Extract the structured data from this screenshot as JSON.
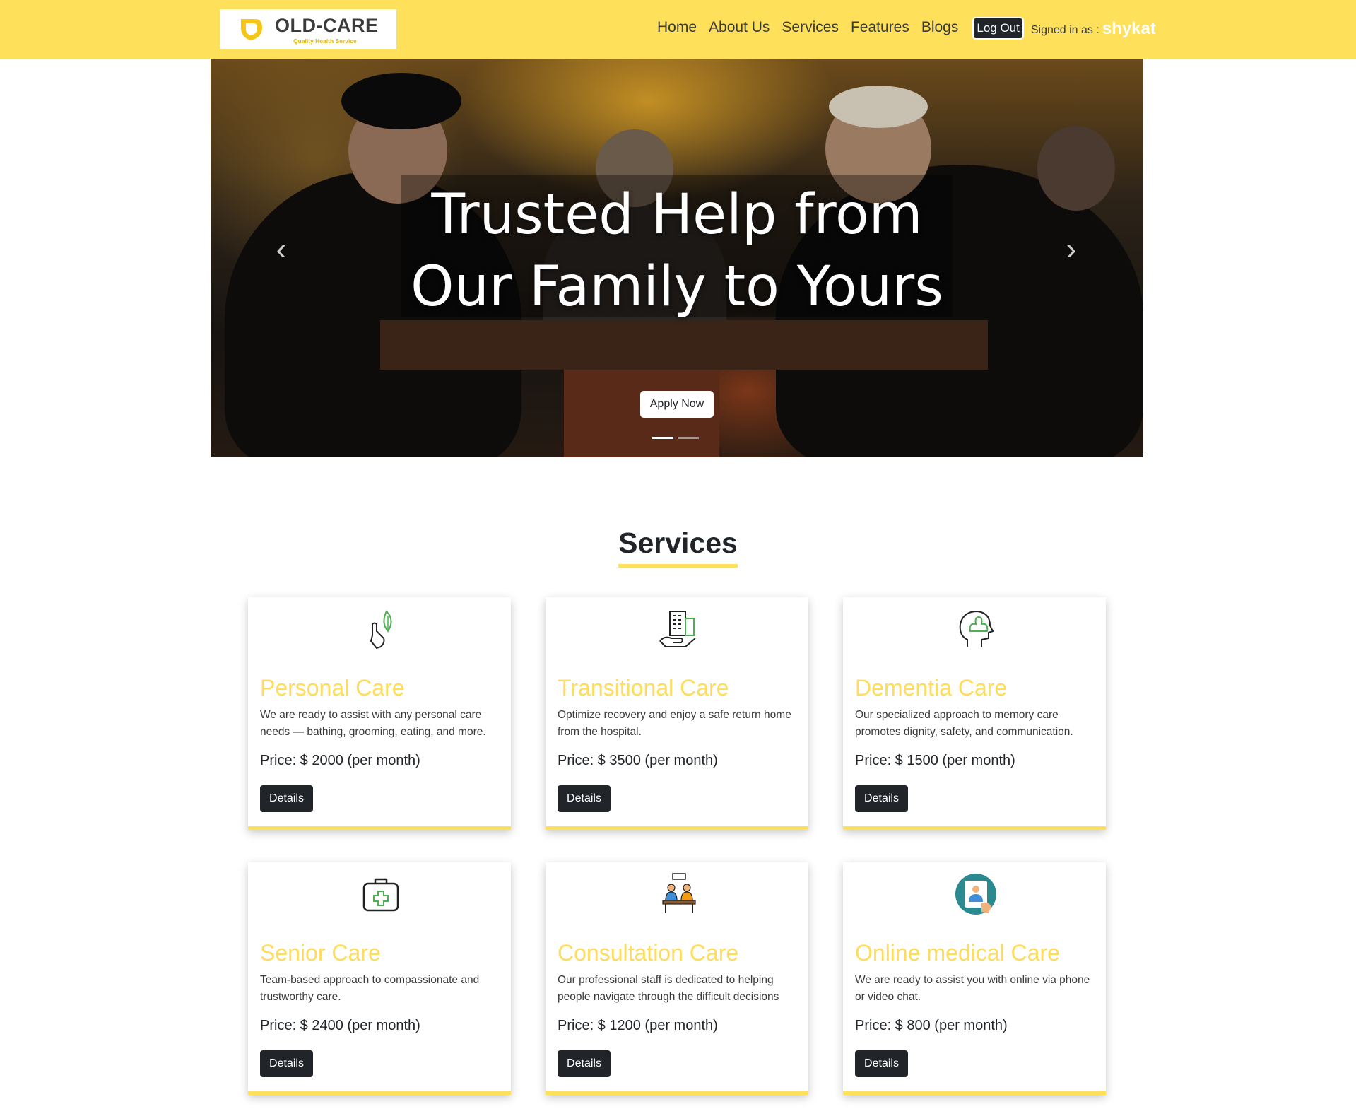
{
  "colors": {
    "brand_yellow": "#ffe05a",
    "title_yellow": "#ffdc5c",
    "dark": "#212529",
    "white": "#ffffff"
  },
  "navbar": {
    "brand_name": "OLD-CARE",
    "brand_tagline": "Quality Health Service",
    "brand_icon": "shield-logo-icon",
    "links": [
      "Home",
      "About Us",
      "Services",
      "Features",
      "Blogs"
    ],
    "logout_label": "Log Out",
    "signed_in_label": "Signed in as :",
    "username": "shykat"
  },
  "hero": {
    "title_line1": "Trusted Help from",
    "title_line2": "Our Family to Yours",
    "cta_label": "Apply Now",
    "prev_icon": "chevron-left-icon",
    "next_icon": "chevron-right-icon",
    "prev_glyph": "‹",
    "next_glyph": "›",
    "slide_count": 2,
    "active_slide": 1
  },
  "services": {
    "heading": "Services",
    "items": [
      {
        "title": "Personal Care",
        "description": "We are ready to assist with any personal care needs — bathing, grooming, eating, and more.",
        "price": "Price: $ 2000 (per month)",
        "button": "Details",
        "icon": "hand-leaf-icon"
      },
      {
        "title": "Transitional Care",
        "description": "Optimize recovery and enjoy a safe return home from the hospital.",
        "price": "Price: $ 3500 (per month)",
        "button": "Details",
        "icon": "hand-building-icon"
      },
      {
        "title": "Dementia Care",
        "description": "Our specialized approach to memory care promotes dignity, safety, and communication.",
        "price": "Price: $ 1500 (per month)",
        "button": "Details",
        "icon": "head-lotus-icon"
      },
      {
        "title": "Senior Care",
        "description": "Team-based approach to compassionate and trustworthy care.",
        "price": "Price: $ 2400 (per month)",
        "button": "Details",
        "icon": "medical-kit-icon"
      },
      {
        "title": "Consultation Care",
        "description": "Our professional staff is dedicated to helping people navigate through the difficult decisions",
        "price": "Price: $ 1200 (per month)",
        "button": "Details",
        "icon": "consultation-desk-icon"
      },
      {
        "title": "Online medical Care",
        "description": "We are ready to assist you with online via phone or video chat.",
        "price": "Price: $ 800 (per month)",
        "button": "Details",
        "icon": "video-doctor-icon"
      }
    ]
  }
}
